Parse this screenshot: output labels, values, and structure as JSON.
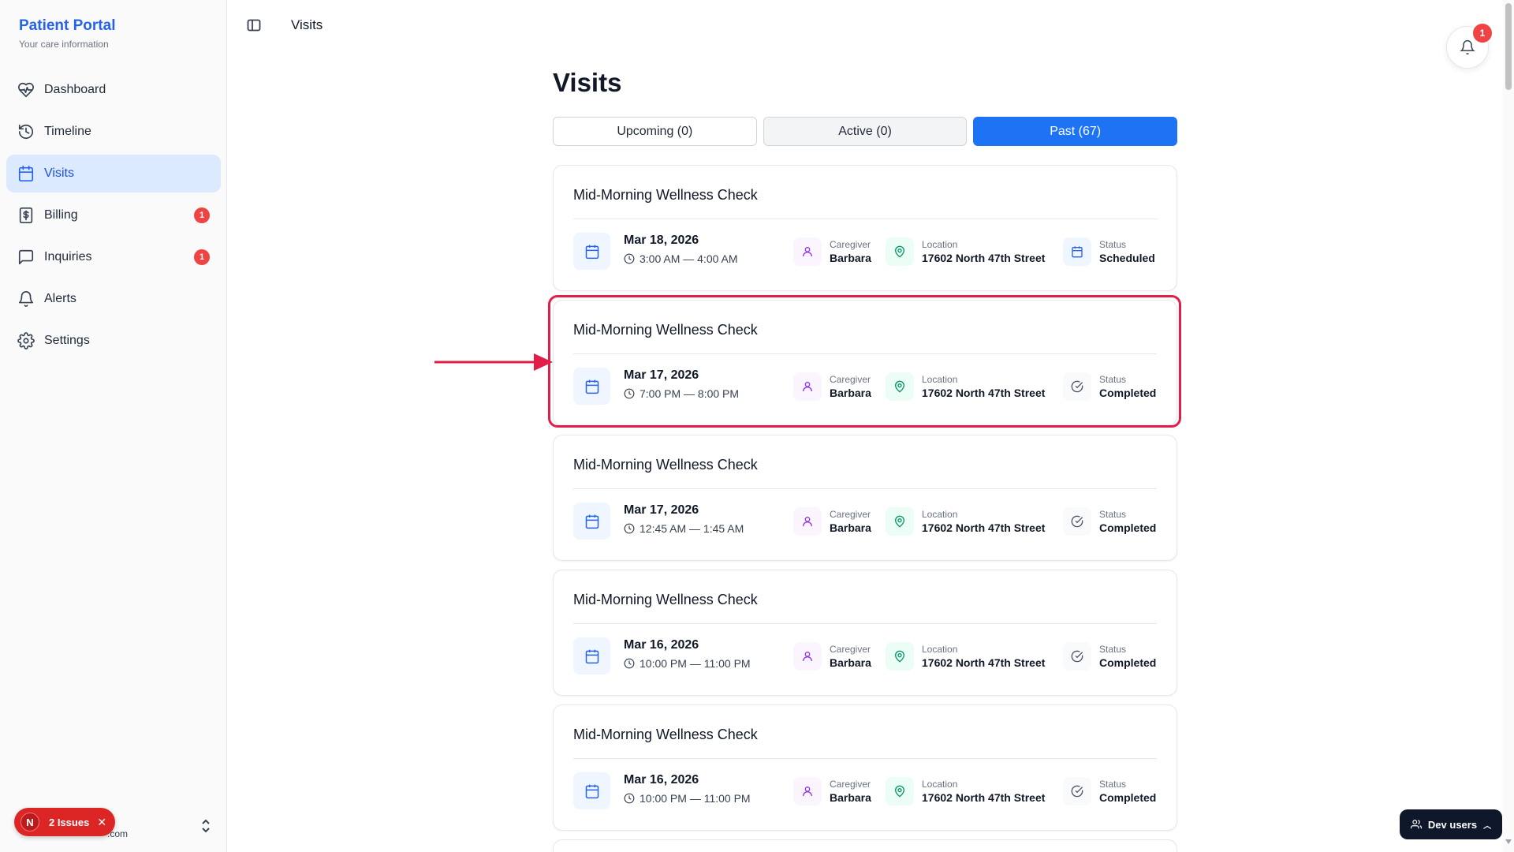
{
  "brand": {
    "title": "Patient Portal",
    "subtitle": "Your care information"
  },
  "sidebar": {
    "items": [
      {
        "label": "Dashboard",
        "icon": "heart-pulse-icon"
      },
      {
        "label": "Timeline",
        "icon": "history-icon"
      },
      {
        "label": "Visits",
        "icon": "calendar-icon",
        "active": true
      },
      {
        "label": "Billing",
        "icon": "receipt-icon",
        "badge": "1"
      },
      {
        "label": "Inquiries",
        "icon": "message-square-icon",
        "badge": "1"
      },
      {
        "label": "Alerts",
        "icon": "bell-icon"
      },
      {
        "label": "Settings",
        "icon": "gear-icon"
      }
    ],
    "issues": {
      "letter": "N",
      "label": "2 Issues"
    },
    "user_email_fragment": ".com"
  },
  "header": {
    "title": "Visits",
    "notifications_count": "1"
  },
  "main": {
    "title": "Visits",
    "tabs": [
      {
        "label": "Upcoming (0)"
      },
      {
        "label": "Active (0)"
      },
      {
        "label": "Past (67)",
        "active": true
      }
    ],
    "labels": {
      "caregiver": "Caregiver",
      "location": "Location",
      "status": "Status"
    },
    "visits": [
      {
        "title": "Mid-Morning Wellness Check",
        "date": "Mar 18, 2026",
        "time": "3:00 AM — 4:00 AM",
        "caregiver": "Barbara",
        "location": "17602 North 47th Street",
        "status": "Scheduled"
      },
      {
        "title": "Mid-Morning Wellness Check",
        "date": "Mar 17, 2026",
        "time": "7:00 PM — 8:00 PM",
        "caregiver": "Barbara",
        "location": "17602 North 47th Street",
        "status": "Completed"
      },
      {
        "title": "Mid-Morning Wellness Check",
        "date": "Mar 17, 2026",
        "time": "12:45 AM — 1:45 AM",
        "caregiver": "Barbara",
        "location": "17602 North 47th Street",
        "status": "Completed"
      },
      {
        "title": "Mid-Morning Wellness Check",
        "date": "Mar 16, 2026",
        "time": "10:00 PM — 11:00 PM",
        "caregiver": "Barbara",
        "location": "17602 North 47th Street",
        "status": "Completed"
      },
      {
        "title": "Mid-Morning Wellness Check",
        "date": "Mar 16, 2026",
        "time": "10:00 PM — 11:00 PM",
        "caregiver": "Barbara",
        "location": "17602 North 47th Street",
        "status": "Completed"
      }
    ]
  },
  "dev_tools": {
    "label": "Dev users"
  },
  "colors": {
    "brand": "#2563eb",
    "active_tab": "#1e73f5",
    "badge": "#ef4444",
    "highlight": "#e11d48"
  }
}
